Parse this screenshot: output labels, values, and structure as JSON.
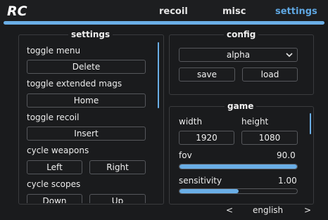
{
  "app": {
    "logo_text": "RC"
  },
  "tabs": [
    {
      "label": "recoil",
      "active": false
    },
    {
      "label": "misc",
      "active": false
    },
    {
      "label": "settings",
      "active": true
    }
  ],
  "accent_color": "#6aaee6",
  "settings": {
    "title": "settings",
    "bindings": [
      {
        "label": "toggle menu",
        "key": "Delete"
      },
      {
        "label": "toggle extended mags",
        "key": "Home"
      },
      {
        "label": "toggle recoil",
        "key": "Insert"
      }
    ],
    "cycle_weapons": {
      "label": "cycle weapons",
      "left": "Left",
      "right": "Right"
    },
    "cycle_scopes": {
      "label": "cycle scopes",
      "left": "Down",
      "right": "Up"
    }
  },
  "config": {
    "title": "config",
    "selected": "alpha",
    "save_label": "save",
    "load_label": "load"
  },
  "game": {
    "title": "game",
    "width_label": "width",
    "height_label": "height",
    "width_value": "1920",
    "height_value": "1080",
    "fov_label": "fov",
    "fov_value": "90.0",
    "fov_fill": 1.0,
    "sensitivity_label": "sensitivity",
    "sensitivity_value": "1.00",
    "sensitivity_fill": 0.5
  },
  "footer": {
    "prev_symbol": "<",
    "language": "english",
    "next_symbol": ">"
  }
}
